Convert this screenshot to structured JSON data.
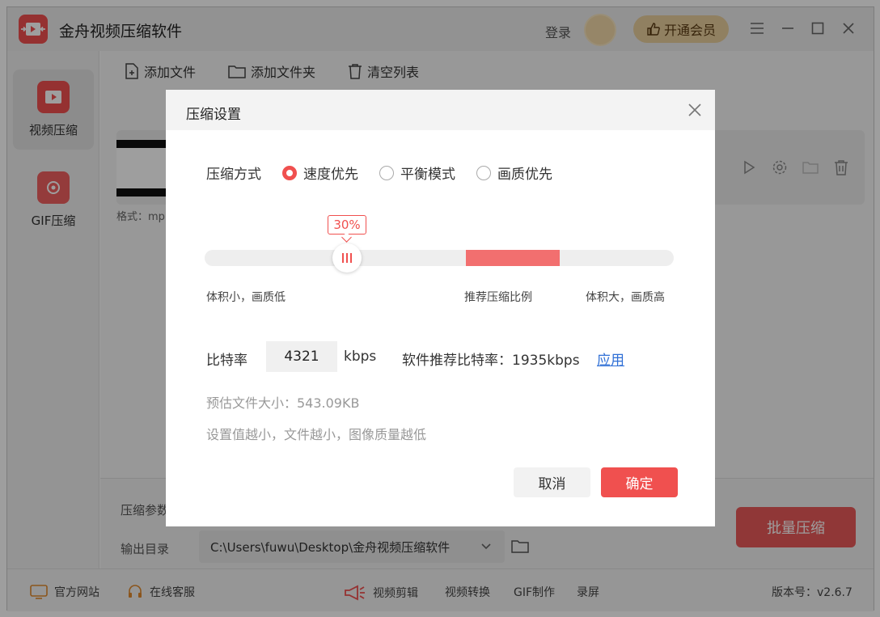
{
  "app": {
    "title": "金舟视频压缩软件",
    "login": "登录",
    "vip_label": "开通会员"
  },
  "sidebar": {
    "items": [
      {
        "label": "视频压缩"
      },
      {
        "label": "GIF压缩"
      }
    ]
  },
  "toolbar": {
    "add_file": "添加文件",
    "add_folder": "添加文件夹",
    "clear_list": "清空列表"
  },
  "file": {
    "format_prefix": "格式：mp"
  },
  "bottom": {
    "params_label": "压缩参数",
    "output_label": "输出目录",
    "output_path": "C:\\Users\\fuwu\\Desktop\\金舟视频压缩软件",
    "batch_label": "批量压缩"
  },
  "statusbar": {
    "website": "官方网站",
    "support": "在线客服",
    "edit": "视频剪辑",
    "convert": "视频转换",
    "gif": "GIF制作",
    "record": "录屏",
    "version": "版本号：v2.6.7"
  },
  "dialog": {
    "title": "压缩设置",
    "mode_label": "压缩方式",
    "modes": [
      {
        "label": "速度优先",
        "selected": true
      },
      {
        "label": "平衡模式",
        "selected": false
      },
      {
        "label": "画质优先",
        "selected": false
      }
    ],
    "slider": {
      "value": 0.3,
      "value_text": "30%",
      "left_label": "体积小，画质低",
      "middle_label": "推荐压缩比例",
      "right_label": "体积大，画质高"
    },
    "bitrate_label": "比特率",
    "bitrate_value": "4321",
    "bitrate_unit": "kbps",
    "recommend_text": "软件推荐比特率：1935kbps",
    "apply_label": "应用",
    "estimate_text": "预估文件大小：543.09KB",
    "hint_text": "设置值越小，文件越小，图像质量越低",
    "cancel_label": "取消",
    "ok_label": "确定"
  },
  "colors": {
    "accent": "#f0504f",
    "recommend_band": "#f26f6f",
    "link": "#2f6fd6",
    "vip": "#e8cf9d"
  }
}
